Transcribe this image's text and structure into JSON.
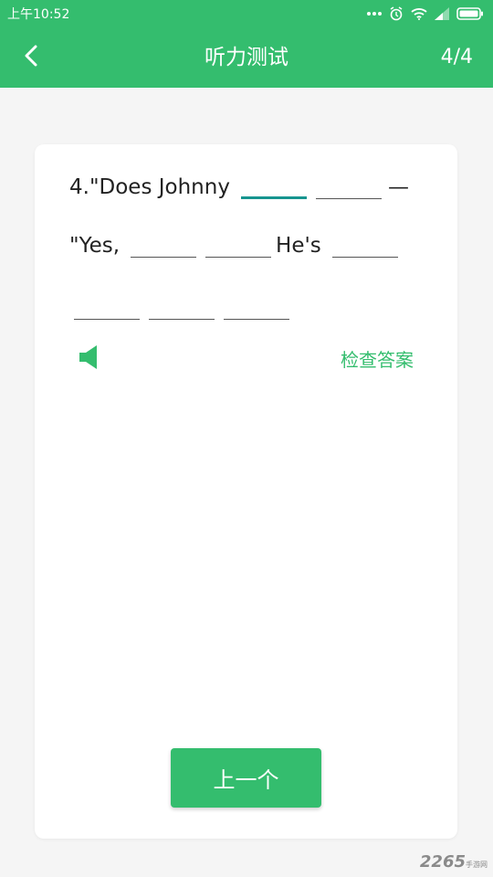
{
  "status_bar": {
    "time": "上午10:52",
    "icons": [
      "more-dots-icon",
      "alarm-icon",
      "wifi-icon",
      "signal-icon",
      "battery-icon"
    ]
  },
  "app_bar": {
    "back_icon": "chevron-left-icon",
    "title": "听力测试",
    "counter": "4/4"
  },
  "question": {
    "line1_text": "4.\"Does Johnny",
    "line1_trailing": "—",
    "line2_prefix": "\"Yes,",
    "line2_mid": "He's",
    "speaker_icon": "speaker-icon",
    "check_answer_label": "检查答案"
  },
  "footer": {
    "prev_button_label": "上一个"
  },
  "watermark": {
    "brand": "2265",
    "sub": "手游网"
  },
  "colors": {
    "accent": "#34bd6e",
    "active_blank": "#17958f"
  }
}
